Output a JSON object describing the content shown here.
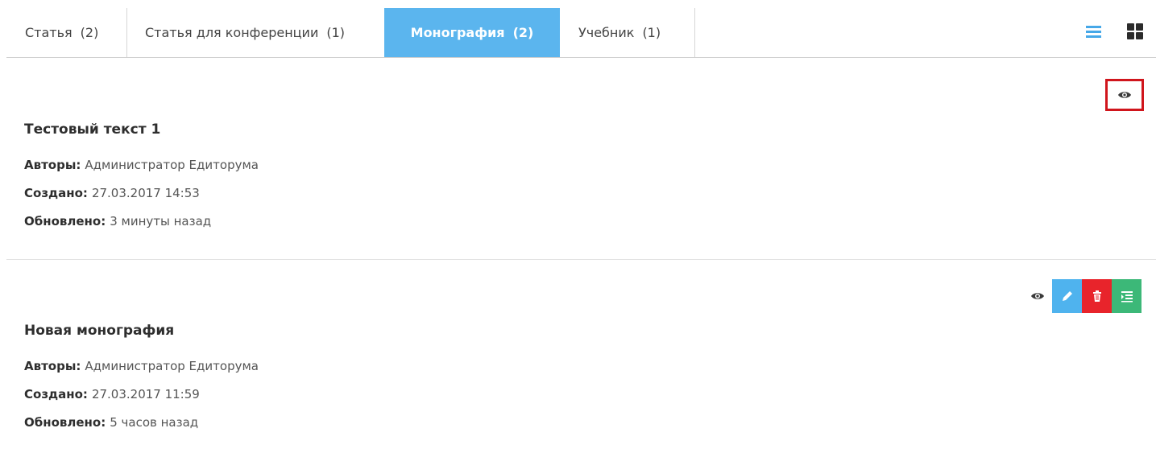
{
  "tabs": [
    {
      "label": "Статья",
      "count": "(2)"
    },
    {
      "label": "Статья для конференции",
      "count": "(1)"
    },
    {
      "label": "Монография",
      "count": "(2)"
    },
    {
      "label": "Учебник",
      "count": "(1)"
    }
  ],
  "active_tab_index": 2,
  "view_icons": [
    "list-view-icon",
    "grid-view-icon"
  ],
  "colors": {
    "active_tab": "#5bb5ee",
    "edit_button": "#4fb3ee",
    "delete_button": "#e8242b",
    "toc_button": "#3cb878",
    "highlight": "#d0151c"
  },
  "labels": {
    "authors": "Авторы:",
    "created": "Создано:",
    "updated": "Обновлено:"
  },
  "items": [
    {
      "title": "Тестовый текст 1",
      "authors": "Администратор Едиторума",
      "created": "27.03.2017 14:53",
      "updated": "3 минуты назад",
      "actions": [
        "view-icon"
      ]
    },
    {
      "title": "Новая монография",
      "authors": "Администратор Едиторума",
      "created": "27.03.2017 11:59",
      "updated": "5 часов назад",
      "actions": [
        "view-icon",
        "edit-icon",
        "delete-icon",
        "toc-icon"
      ]
    }
  ]
}
